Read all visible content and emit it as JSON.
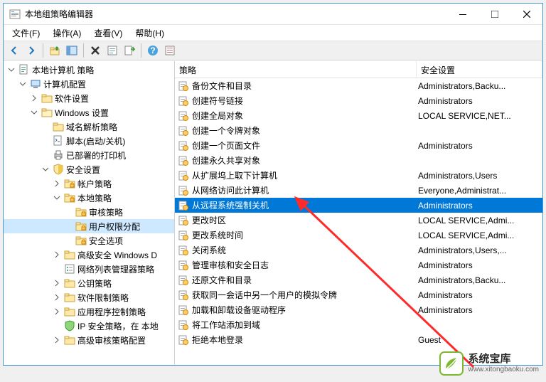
{
  "window": {
    "title": "本地组策略编辑器"
  },
  "menu": {
    "file": "文件(F)",
    "action": "操作(A)",
    "view": "查看(V)",
    "help": "帮助(H)"
  },
  "tree": {
    "root": "本地计算机 策略",
    "computer_config": "计算机配置",
    "software_settings": "软件设置",
    "windows_settings": "Windows 设置",
    "name_resolution": "域名解析策略",
    "scripts": "脚本(启动/关机)",
    "deployed_printers": "已部署的打印机",
    "security_settings": "安全设置",
    "account_policies": "帐户策略",
    "local_policies": "本地策略",
    "audit_policy": "审核策略",
    "user_rights": "用户权限分配",
    "security_options": "安全选项",
    "advanced_windows": "高级安全 Windows D",
    "network_list": "网络列表管理器策略",
    "public_key": "公钥策略",
    "software_restriction": "软件限制策略",
    "app_control": "应用程序控制策略",
    "ip_security": "IP 安全策略，在 本地",
    "advanced_audit": "高级审核策略配置"
  },
  "columns": {
    "policy": "策略",
    "security_setting": "安全设置"
  },
  "rows": [
    {
      "name": "备份文件和目录",
      "setting": "Administrators,Backu..."
    },
    {
      "name": "创建符号链接",
      "setting": "Administrators"
    },
    {
      "name": "创建全局对象",
      "setting": "LOCAL SERVICE,NET..."
    },
    {
      "name": "创建一个令牌对象",
      "setting": ""
    },
    {
      "name": "创建一个页面文件",
      "setting": "Administrators"
    },
    {
      "name": "创建永久共享对象",
      "setting": ""
    },
    {
      "name": "从扩展坞上取下计算机",
      "setting": "Administrators,Users"
    },
    {
      "name": "从网络访问此计算机",
      "setting": "Everyone,Administrat..."
    },
    {
      "name": "从远程系统强制关机",
      "setting": "Administrators"
    },
    {
      "name": "更改时区",
      "setting": "LOCAL SERVICE,Admi..."
    },
    {
      "name": "更改系统时间",
      "setting": "LOCAL SERVICE,Admi..."
    },
    {
      "name": "关闭系统",
      "setting": "Administrators,Users,..."
    },
    {
      "name": "管理审核和安全日志",
      "setting": "Administrators"
    },
    {
      "name": "还原文件和目录",
      "setting": "Administrators,Backu..."
    },
    {
      "name": "获取同一会话中另一个用户的模拟令牌",
      "setting": "Administrators"
    },
    {
      "name": "加载和卸载设备驱动程序",
      "setting": "Administrators"
    },
    {
      "name": "将工作站添加到域",
      "setting": ""
    },
    {
      "name": "拒绝本地登录",
      "setting": "Guest"
    }
  ],
  "watermark": {
    "title": "系统宝库",
    "url": "www.xitongbaoku.com"
  }
}
